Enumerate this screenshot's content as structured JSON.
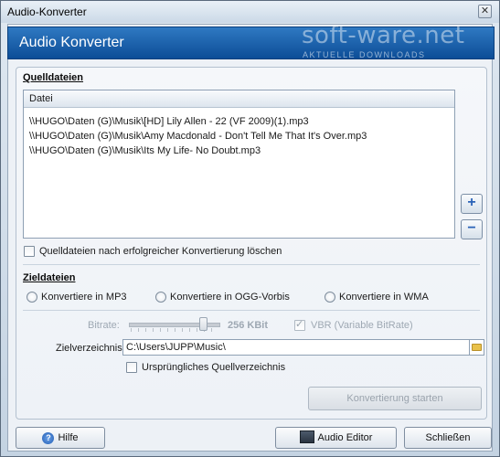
{
  "window": {
    "title": "Audio-Konverter",
    "close_glyph": "✕"
  },
  "header": {
    "title": "Audio Konverter",
    "watermark": "soft-ware.net",
    "watermark_sub": "AKTUELLE DOWNLOADS"
  },
  "source": {
    "section_label": "Quelldateien",
    "column_header": "Datei",
    "files": [
      "\\\\HUGO\\Daten (G)\\Musik\\[HD] Lily Allen - 22 (VF 2009)(1).mp3",
      "\\\\HUGO\\Daten (G)\\Musik\\Amy Macdonald - Don't Tell Me That It's Over.mp3",
      "\\\\HUGO\\Daten (G)\\Musik\\Its My Life- No Doubt.mp3"
    ],
    "add_glyph": "+",
    "remove_glyph": "−",
    "delete_after_label": "Quelldateien nach erfolgreicher Konvertierung löschen"
  },
  "target": {
    "section_label": "Zieldateien",
    "formats": [
      "Konvertiere in MP3",
      "Konvertiere in OGG-Vorbis",
      "Konvertiere in WMA"
    ],
    "bitrate_label": "Bitrate:",
    "bitrate_value": "256 KBit",
    "vbr_label": "VBR (Variable BitRate)",
    "dir_label": "Zielverzeichnis:",
    "dir_value": "C:\\Users\\JUPP\\Music\\",
    "original_dir_label": "Ursprüngliches Quellverzeichnis"
  },
  "actions": {
    "start_label": "Konvertierung starten",
    "help_label": "Hilfe",
    "editor_label": "Audio Editor",
    "close_label": "Schließen"
  },
  "colors": {
    "header_blue": "#1a5fae",
    "accent_button": "#2a63b8"
  }
}
